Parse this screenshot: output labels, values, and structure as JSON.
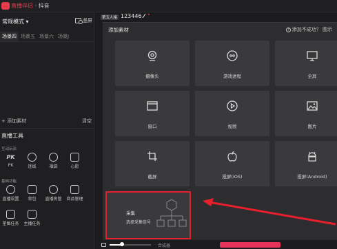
{
  "app": {
    "title_brand": "直播伴侣",
    "title_sep": " · ",
    "title_platform": "抖音"
  },
  "left": {
    "mode": "常规模式",
    "project_btn": "竖屏",
    "scene_tabs": [
      "场景四",
      "场景五",
      "场景六",
      "场景J"
    ],
    "add_source": "+ 添加素材",
    "clear": "清空",
    "tools_title": "直播工具",
    "group_interact": "互动玩法",
    "interact_tools": [
      "PK",
      "连线",
      "福袋",
      "心愿"
    ],
    "group_basic": "基础功能",
    "basic_tools": [
      "直播设置",
      "背包",
      "直播房管",
      "商品管理"
    ],
    "extra_tools": [
      "星图任务",
      "主播任务"
    ]
  },
  "header": {
    "scene_badge": "第五人格",
    "room_id": "123446"
  },
  "dialog": {
    "title": "添加素材",
    "help": "添加不成功？ 图示",
    "tiles": [
      {
        "label": "摄像头",
        "icon": "camera-icon"
      },
      {
        "label": "游戏进程",
        "icon": "gamepad-icon"
      },
      {
        "label": "全屏",
        "icon": "monitor-icon"
      },
      {
        "label": "窗口",
        "icon": "window-icon"
      },
      {
        "label": "视频",
        "icon": "play-icon"
      },
      {
        "label": "图片",
        "icon": "image-icon"
      },
      {
        "label": "截屏",
        "icon": "crop-icon"
      },
      {
        "label": "投屏(iOS)",
        "icon": "apple-icon"
      },
      {
        "label": "投屏(Android)",
        "icon": "android-icon"
      }
    ],
    "capture": {
      "name": "采集",
      "desc": "选择采集信号"
    }
  },
  "bottom": {
    "vu_label": "合成器",
    "volume": 0.3
  },
  "colors": {
    "accent": "#e83a4b",
    "highlight": "#e81f2c",
    "go": "#e6335a"
  }
}
